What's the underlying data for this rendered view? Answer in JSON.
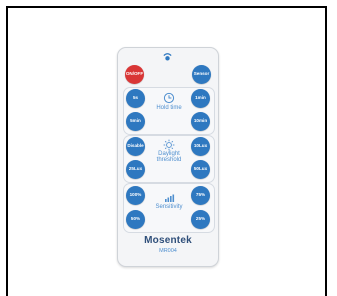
{
  "remote": {
    "top_buttons": {
      "power": "ON/OFF",
      "sensor": "Sensor"
    },
    "hold_time": {
      "label": "Hold time",
      "buttons": [
        "5s",
        "1min",
        "5min",
        "10min"
      ]
    },
    "daylight_threshold": {
      "label_line1": "Daylight",
      "label_line2": "threshold",
      "buttons": [
        "Disable",
        "10Lux",
        "25Lux",
        "50Lux"
      ]
    },
    "sensitivity": {
      "label": "Sensitivity",
      "buttons": [
        "100%",
        "75%",
        "50%",
        "25%"
      ]
    },
    "brand": "Mosentek",
    "model": "MR004"
  },
  "colors": {
    "button_blue": "#2e78c0",
    "power_red": "#d93636",
    "label_blue": "#4f8fcf"
  },
  "icons": [
    "ir-emitter-icon",
    "clock-icon",
    "sun-icon",
    "signal-bars-icon"
  ]
}
